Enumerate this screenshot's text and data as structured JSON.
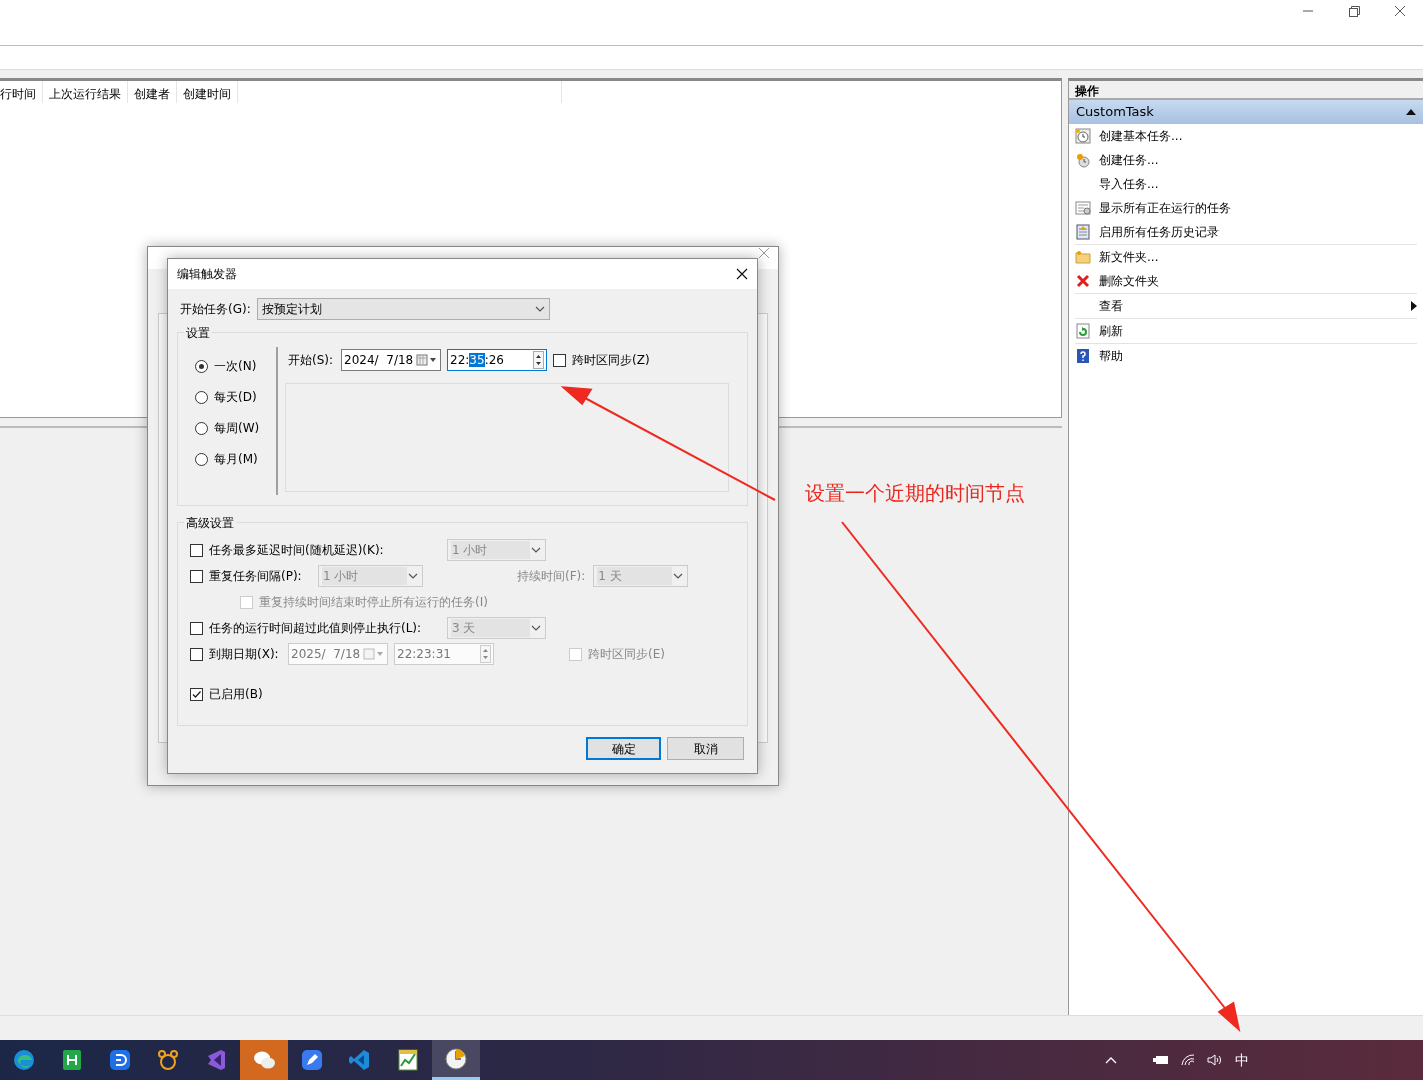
{
  "task_table": {
    "columns": [
      "行时间",
      "上次运行结果",
      "创建者",
      "创建时间"
    ]
  },
  "actions_panel": {
    "title": "操作",
    "section": {
      "title": "CustomTask",
      "expanded": true
    },
    "groups": [
      [
        {
          "label": "创建基本任务...",
          "submenu": false
        },
        {
          "label": "创建任务...",
          "submenu": false
        },
        {
          "label": "导入任务...",
          "submenu": false
        },
        {
          "label": "显示所有正在运行的任务",
          "submenu": false
        },
        {
          "label": "启用所有任务历史记录",
          "submenu": false
        }
      ],
      [
        {
          "label": "新文件夹...",
          "submenu": false
        },
        {
          "label": "删除文件夹",
          "submenu": false
        }
      ],
      [
        {
          "label": "查看",
          "submenu": true
        }
      ],
      [
        {
          "label": "刷新",
          "submenu": false
        }
      ],
      [
        {
          "label": "帮助",
          "submenu": false
        }
      ]
    ]
  },
  "trigger_dialog": {
    "title": "编辑触发器",
    "begin_label": "开始任务(G):",
    "begin_value": "按预定计划",
    "settings_title": "设置",
    "schedule_options": [
      {
        "label": "一次(N)",
        "selected": true
      },
      {
        "label": "每天(D)",
        "selected": false
      },
      {
        "label": "每周(W)",
        "selected": false
      },
      {
        "label": "每月(M)",
        "selected": false
      }
    ],
    "start_label": "开始(S):",
    "start_date": "2024/  7/18",
    "start_time": {
      "before": "22:",
      "selected": "35",
      "after": ":26"
    },
    "sync_timezone": {
      "label": "跨时区同步(Z)",
      "checked": false
    },
    "advanced_title": "高级设置",
    "delay": {
      "label": "任务最多延迟时间(随机延迟)(K):",
      "checked": false,
      "value": "1 小时"
    },
    "repeat": {
      "label": "重复任务间隔(P):",
      "checked": false,
      "value": "1 小时",
      "duration_label": "持续时间(F):",
      "duration_value": "1 天"
    },
    "stop_at_end": {
      "label": "重复持续时间结束时停止所有运行的任务(I)",
      "checked": false,
      "disabled": true
    },
    "stop_if_longer": {
      "label": "任务的运行时间超过此值则停止执行(L):",
      "checked": false,
      "value": "3 天"
    },
    "expire": {
      "label": "到期日期(X):",
      "checked": false,
      "date": "2025/  7/18",
      "time": "22:23:31",
      "sync_label": "跨时区同步(E)",
      "sync_checked": false
    },
    "enabled": {
      "label": "已启用(B)",
      "checked": true
    },
    "buttons": [
      {
        "label": "确定",
        "default": true
      },
      {
        "label": "取消",
        "default": false
      }
    ]
  },
  "annotation": {
    "text": "设置一个近期的时间节点"
  },
  "taskbar": {
    "apps": [
      {
        "active": false,
        "flashing": false
      },
      {
        "active": false,
        "flashing": false
      },
      {
        "active": false,
        "flashing": false
      },
      {
        "active": false,
        "flashing": false
      },
      {
        "active": false,
        "flashing": false
      },
      {
        "active": false,
        "flashing": true
      },
      {
        "active": false,
        "flashing": false
      },
      {
        "active": false,
        "flashing": false
      },
      {
        "active": false,
        "flashing": false
      },
      {
        "active": true,
        "flashing": false
      }
    ],
    "ime": "中"
  }
}
